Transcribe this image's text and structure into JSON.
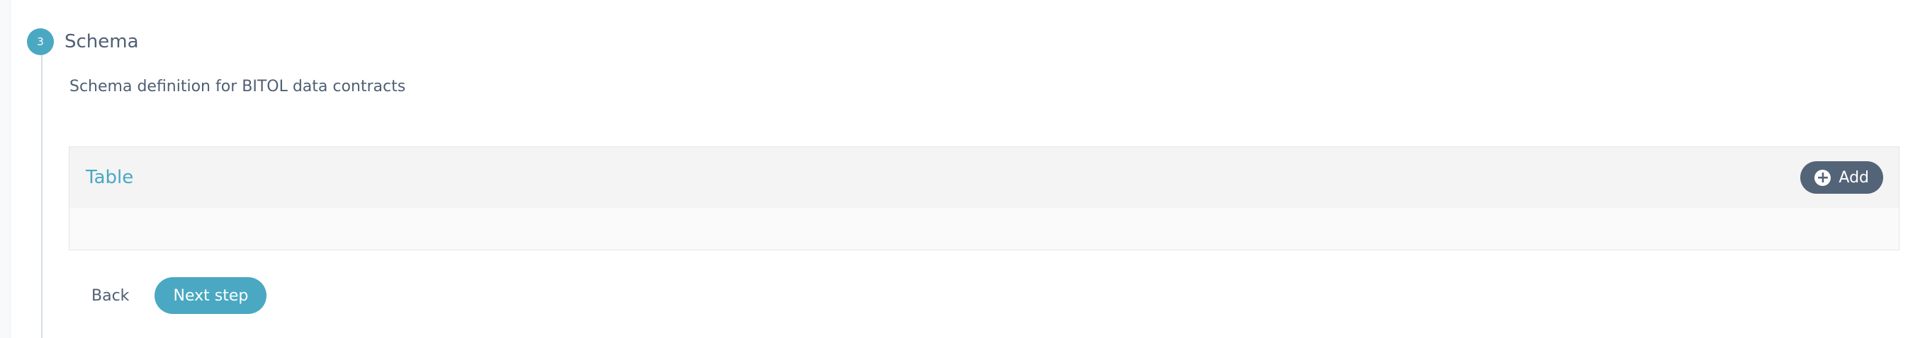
{
  "step": {
    "number": "3",
    "title": "Schema",
    "description": "Schema definition for BITOL data contracts"
  },
  "panel": {
    "title": "Table",
    "add_label": "Add",
    "add_icon": "plus-circle-icon"
  },
  "actions": {
    "back_label": "Back",
    "next_label": "Next step"
  },
  "colors": {
    "accent": "#4aa8c2",
    "button_dark": "#536478",
    "text": "#4f5f73",
    "panel_header": "#f4f4f4",
    "panel_body": "#fafafa"
  }
}
